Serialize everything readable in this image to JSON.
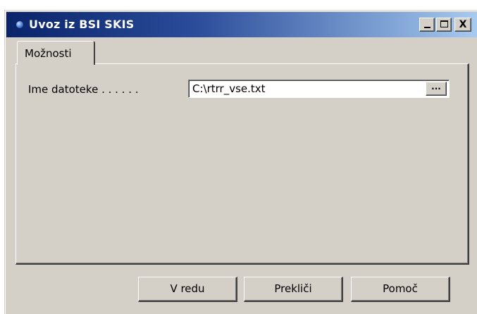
{
  "window": {
    "title": "Uvoz iz BSI SKIS",
    "controls": {
      "minimize": "_",
      "maximize": "□",
      "close": "X"
    }
  },
  "tabs": [
    {
      "label": "Možnosti",
      "active": true
    }
  ],
  "form": {
    "file_label": "Ime datoteke . . . . . .",
    "file_value": "C:\\rtrr_vse.txt",
    "browse_label": "..."
  },
  "buttons": {
    "ok": "V redu",
    "cancel": "Prekliči",
    "help": "Pomoč"
  },
  "colors": {
    "title_start": "#0a246a",
    "title_end": "#a6caf0",
    "face": "#d4d0c8"
  }
}
